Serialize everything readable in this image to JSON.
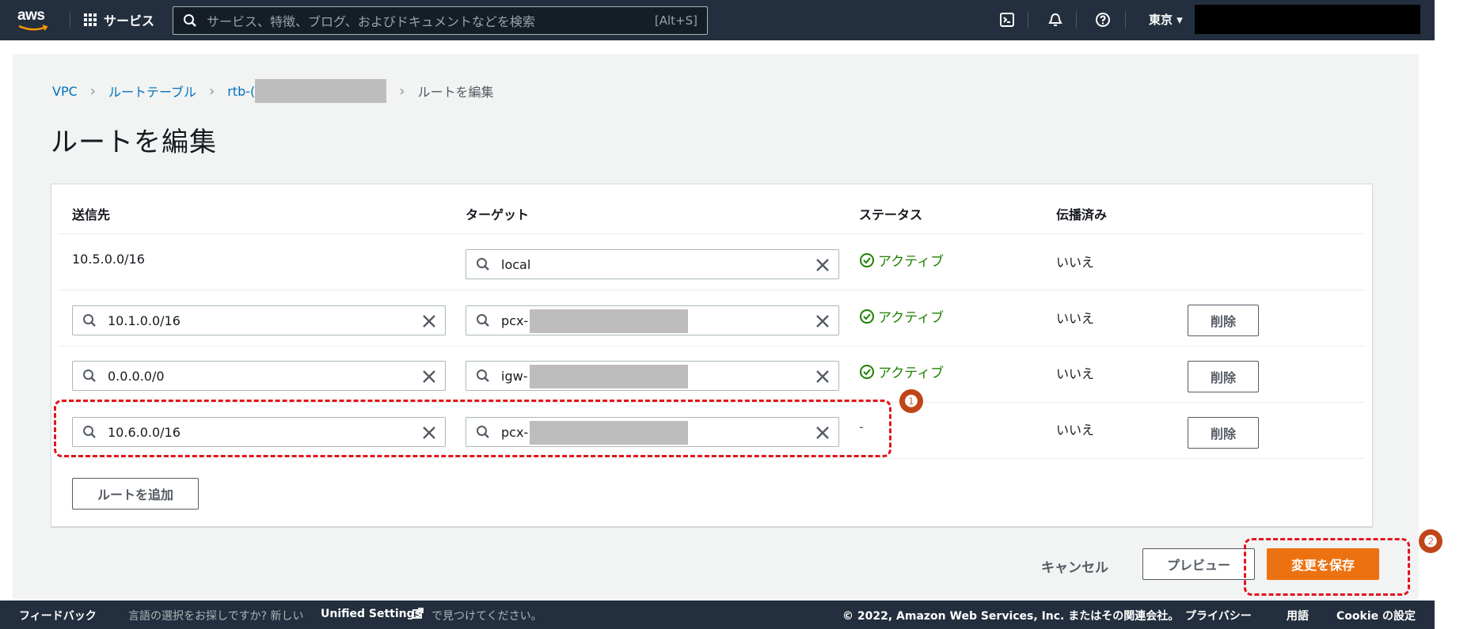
{
  "topnav": {
    "logo_text": "aws",
    "services_label": "サービス",
    "search_placeholder": "サービス、特徴、ブログ、およびドキュメントなどを検索",
    "search_shortcut": "[Alt+S]",
    "region_label": "東京 ▾",
    "icons": [
      "cloudshell-icon",
      "notifications-icon",
      "help-icon"
    ]
  },
  "breadcrumb": {
    "items": [
      "VPC",
      "ルートテーブル",
      "rtb-("
    ],
    "current": "ルートを編集"
  },
  "page_title": "ルートを編集",
  "table": {
    "headers": [
      "送信先",
      "ターゲット",
      "ステータス",
      "伝播済み"
    ],
    "rows": [
      {
        "destination": "10.5.0.0/16",
        "target": "local",
        "status": "アクティブ",
        "propagated": "いいえ"
      },
      {
        "destination": "10.1.0.0/16",
        "target": "pcx-",
        "status": "アクティブ",
        "propagated": "いいえ",
        "remove_label": "削除"
      },
      {
        "destination": "0.0.0.0/0",
        "target": "igw-",
        "status": "アクティブ",
        "propagated": "いいえ",
        "remove_label": "削除"
      },
      {
        "destination": "10.6.0.0/16",
        "target": "pcx-",
        "status": "-",
        "propagated": "いいえ",
        "remove_label": "削除"
      }
    ],
    "add_route_label": "ルートを追加"
  },
  "actions": {
    "cancel_label": "キャンセル",
    "preview_label": "プレビュー",
    "save_label": "変更を保存"
  },
  "annotations": {
    "marker_1": "❶",
    "marker_2": "❷",
    "callout_color": "#e2141c"
  },
  "footer": {
    "feedback": "フィードバック",
    "lang_text_1": "言語の選択をお探しですか? 新しい",
    "lang_link": "Unified Settings",
    "lang_text_2": "で見つけてください。",
    "copyright": "© 2022, Amazon Web Services, Inc. またはその関連会社。",
    "privacy": "プライバシー",
    "terms": "用語",
    "cookie": "Cookie の設定"
  },
  "colors": {
    "nav_bg": "#232f3e",
    "accent_orange": "#ec7211",
    "link_blue": "#0073bb",
    "status_green": "#1d8102"
  }
}
